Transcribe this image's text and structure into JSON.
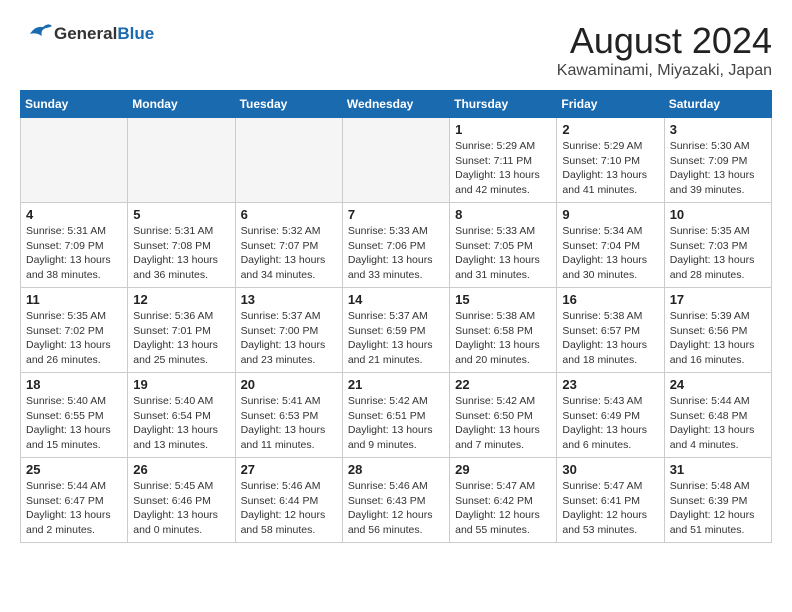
{
  "header": {
    "logo_general": "General",
    "logo_blue": "Blue",
    "month": "August 2024",
    "location": "Kawaminami, Miyazaki, Japan"
  },
  "weekdays": [
    "Sunday",
    "Monday",
    "Tuesday",
    "Wednesday",
    "Thursday",
    "Friday",
    "Saturday"
  ],
  "weeks": [
    [
      {
        "day": "",
        "info": ""
      },
      {
        "day": "",
        "info": ""
      },
      {
        "day": "",
        "info": ""
      },
      {
        "day": "",
        "info": ""
      },
      {
        "day": "1",
        "info": "Sunrise: 5:29 AM\nSunset: 7:11 PM\nDaylight: 13 hours\nand 42 minutes."
      },
      {
        "day": "2",
        "info": "Sunrise: 5:29 AM\nSunset: 7:10 PM\nDaylight: 13 hours\nand 41 minutes."
      },
      {
        "day": "3",
        "info": "Sunrise: 5:30 AM\nSunset: 7:09 PM\nDaylight: 13 hours\nand 39 minutes."
      }
    ],
    [
      {
        "day": "4",
        "info": "Sunrise: 5:31 AM\nSunset: 7:09 PM\nDaylight: 13 hours\nand 38 minutes."
      },
      {
        "day": "5",
        "info": "Sunrise: 5:31 AM\nSunset: 7:08 PM\nDaylight: 13 hours\nand 36 minutes."
      },
      {
        "day": "6",
        "info": "Sunrise: 5:32 AM\nSunset: 7:07 PM\nDaylight: 13 hours\nand 34 minutes."
      },
      {
        "day": "7",
        "info": "Sunrise: 5:33 AM\nSunset: 7:06 PM\nDaylight: 13 hours\nand 33 minutes."
      },
      {
        "day": "8",
        "info": "Sunrise: 5:33 AM\nSunset: 7:05 PM\nDaylight: 13 hours\nand 31 minutes."
      },
      {
        "day": "9",
        "info": "Sunrise: 5:34 AM\nSunset: 7:04 PM\nDaylight: 13 hours\nand 30 minutes."
      },
      {
        "day": "10",
        "info": "Sunrise: 5:35 AM\nSunset: 7:03 PM\nDaylight: 13 hours\nand 28 minutes."
      }
    ],
    [
      {
        "day": "11",
        "info": "Sunrise: 5:35 AM\nSunset: 7:02 PM\nDaylight: 13 hours\nand 26 minutes."
      },
      {
        "day": "12",
        "info": "Sunrise: 5:36 AM\nSunset: 7:01 PM\nDaylight: 13 hours\nand 25 minutes."
      },
      {
        "day": "13",
        "info": "Sunrise: 5:37 AM\nSunset: 7:00 PM\nDaylight: 13 hours\nand 23 minutes."
      },
      {
        "day": "14",
        "info": "Sunrise: 5:37 AM\nSunset: 6:59 PM\nDaylight: 13 hours\nand 21 minutes."
      },
      {
        "day": "15",
        "info": "Sunrise: 5:38 AM\nSunset: 6:58 PM\nDaylight: 13 hours\nand 20 minutes."
      },
      {
        "day": "16",
        "info": "Sunrise: 5:38 AM\nSunset: 6:57 PM\nDaylight: 13 hours\nand 18 minutes."
      },
      {
        "day": "17",
        "info": "Sunrise: 5:39 AM\nSunset: 6:56 PM\nDaylight: 13 hours\nand 16 minutes."
      }
    ],
    [
      {
        "day": "18",
        "info": "Sunrise: 5:40 AM\nSunset: 6:55 PM\nDaylight: 13 hours\nand 15 minutes."
      },
      {
        "day": "19",
        "info": "Sunrise: 5:40 AM\nSunset: 6:54 PM\nDaylight: 13 hours\nand 13 minutes."
      },
      {
        "day": "20",
        "info": "Sunrise: 5:41 AM\nSunset: 6:53 PM\nDaylight: 13 hours\nand 11 minutes."
      },
      {
        "day": "21",
        "info": "Sunrise: 5:42 AM\nSunset: 6:51 PM\nDaylight: 13 hours\nand 9 minutes."
      },
      {
        "day": "22",
        "info": "Sunrise: 5:42 AM\nSunset: 6:50 PM\nDaylight: 13 hours\nand 7 minutes."
      },
      {
        "day": "23",
        "info": "Sunrise: 5:43 AM\nSunset: 6:49 PM\nDaylight: 13 hours\nand 6 minutes."
      },
      {
        "day": "24",
        "info": "Sunrise: 5:44 AM\nSunset: 6:48 PM\nDaylight: 13 hours\nand 4 minutes."
      }
    ],
    [
      {
        "day": "25",
        "info": "Sunrise: 5:44 AM\nSunset: 6:47 PM\nDaylight: 13 hours\nand 2 minutes."
      },
      {
        "day": "26",
        "info": "Sunrise: 5:45 AM\nSunset: 6:46 PM\nDaylight: 13 hours\nand 0 minutes."
      },
      {
        "day": "27",
        "info": "Sunrise: 5:46 AM\nSunset: 6:44 PM\nDaylight: 12 hours\nand 58 minutes."
      },
      {
        "day": "28",
        "info": "Sunrise: 5:46 AM\nSunset: 6:43 PM\nDaylight: 12 hours\nand 56 minutes."
      },
      {
        "day": "29",
        "info": "Sunrise: 5:47 AM\nSunset: 6:42 PM\nDaylight: 12 hours\nand 55 minutes."
      },
      {
        "day": "30",
        "info": "Sunrise: 5:47 AM\nSunset: 6:41 PM\nDaylight: 12 hours\nand 53 minutes."
      },
      {
        "day": "31",
        "info": "Sunrise: 5:48 AM\nSunset: 6:39 PM\nDaylight: 12 hours\nand 51 minutes."
      }
    ]
  ]
}
